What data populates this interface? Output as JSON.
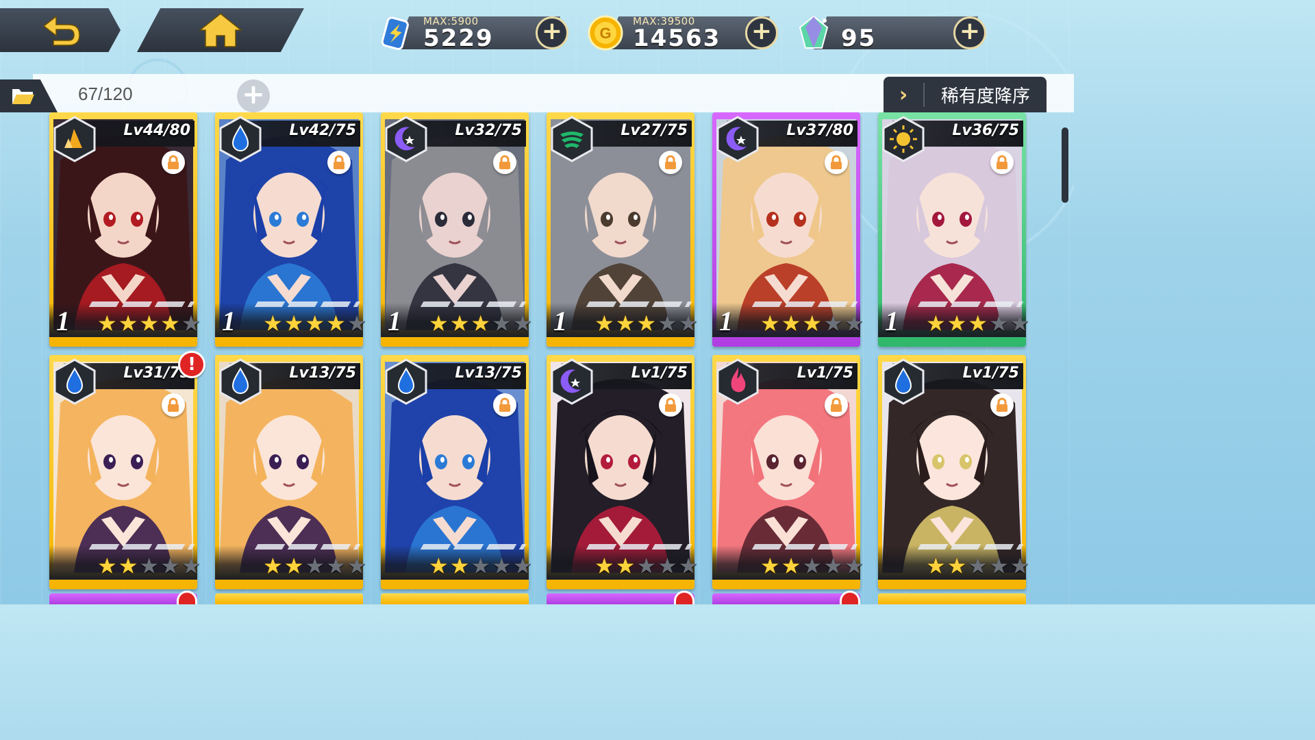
{
  "resources": [
    {
      "id": "stamina",
      "max_label": "MAX:5900",
      "value": "5229",
      "icon": "battery-bolt-icon"
    },
    {
      "id": "gold",
      "max_label": "MAX:39500",
      "value": "14563",
      "icon": "gold-coin-icon"
    },
    {
      "id": "gems",
      "max_label": "",
      "value": "95",
      "icon": "crystal-icon"
    }
  ],
  "inventory": {
    "count": "67/120"
  },
  "sort": {
    "label": "稀有度降序",
    "chevron": "›"
  },
  "cards": [
    {
      "level": "Lv44/80",
      "element": "earth",
      "element_color": "#f2a81d",
      "frame": "gold",
      "count": "1",
      "stars": 4,
      "locked": true,
      "alert": false,
      "hair": "#3b1518",
      "skin": "#f4d6c8",
      "accent": "#b31b22"
    },
    {
      "level": "Lv42/75",
      "element": "water",
      "element_color": "#1f6fe0",
      "frame": "gold",
      "count": "1",
      "stars": 4,
      "locked": true,
      "alert": false,
      "hair": "#1b3fa8",
      "skin": "#f6dcd0",
      "accent": "#2b7bd6"
    },
    {
      "level": "Lv32/75",
      "element": "dark",
      "element_color": "#8b5cf6",
      "frame": "gold",
      "count": "1",
      "stars": 3,
      "locked": true,
      "alert": false,
      "hair": "#8d8d93",
      "skin": "#e9d2cf",
      "accent": "#2b2b3a"
    },
    {
      "level": "Lv27/75",
      "element": "wind",
      "element_color": "#1fb86a",
      "frame": "gold",
      "count": "1",
      "stars": 3,
      "locked": true,
      "alert": false,
      "hair": "#8c8f98",
      "skin": "#f1d9cc",
      "accent": "#4a3b2e"
    },
    {
      "level": "Lv37/80",
      "element": "dark",
      "element_color": "#8b5cf6",
      "frame": "purple",
      "count": "1",
      "stars": 3,
      "locked": true,
      "alert": false,
      "hair": "#f0c78a",
      "skin": "#f6dcd0",
      "accent": "#b5311e"
    },
    {
      "level": "Lv36/75",
      "element": "light",
      "element_color": "#f4c430",
      "frame": "green",
      "count": "1",
      "stars": 3,
      "locked": true,
      "alert": false,
      "hair": "#d8c8dc",
      "skin": "#f7e2d9",
      "accent": "#a3173d"
    },
    {
      "level": "Lv31/75",
      "element": "water",
      "element_color": "#1f6fe0",
      "frame": "gold",
      "count": "",
      "stars": 2,
      "locked": true,
      "alert": true,
      "hair": "#f4b25a",
      "skin": "#fbe5d8",
      "accent": "#3b1f54"
    },
    {
      "level": "Lv13/75",
      "element": "water",
      "element_color": "#1f6fe0",
      "frame": "gold",
      "count": "",
      "stars": 2,
      "locked": false,
      "alert": false,
      "hair": "#f4b25a",
      "skin": "#fbe5d8",
      "accent": "#3b1f54"
    },
    {
      "level": "Lv13/75",
      "element": "water",
      "element_color": "#1f6fe0",
      "frame": "gold",
      "count": "",
      "stars": 2,
      "locked": true,
      "alert": false,
      "hair": "#1b3fa8",
      "skin": "#f6dcd0",
      "accent": "#2b7bd6"
    },
    {
      "level": "Lv1/75",
      "element": "dark",
      "element_color": "#8b5cf6",
      "frame": "gold",
      "count": "",
      "stars": 2,
      "locked": true,
      "alert": false,
      "hair": "#17131c",
      "skin": "#f6dcd0",
      "accent": "#b31b3c"
    },
    {
      "level": "Lv1/75",
      "element": "fire",
      "element_color": "#f0457a",
      "frame": "gold",
      "count": "",
      "stars": 2,
      "locked": true,
      "alert": false,
      "hair": "#f2727a",
      "skin": "#fbe0d6",
      "accent": "#5a2430"
    },
    {
      "level": "Lv1/75",
      "element": "water",
      "element_color": "#1f6fe0",
      "frame": "gold",
      "count": "",
      "stars": 2,
      "locked": true,
      "alert": false,
      "hair": "#2a1c1c",
      "skin": "#fbe5dc",
      "accent": "#d8c46a"
    }
  ],
  "peek_row": [
    {
      "frame": "purple",
      "alert": true
    },
    {
      "frame": "gold",
      "alert": false
    },
    {
      "frame": "gold",
      "alert": false
    },
    {
      "frame": "purple",
      "alert": true
    },
    {
      "frame": "purple",
      "alert": true
    },
    {
      "frame": "gold",
      "alert": false
    }
  ],
  "alert_mark": "!"
}
